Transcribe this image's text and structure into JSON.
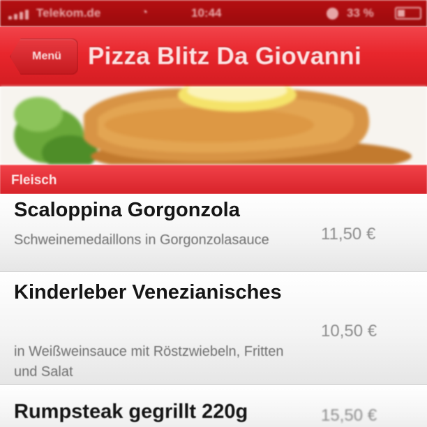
{
  "status_bar": {
    "carrier": "Telekom.de",
    "time": "10:44",
    "battery": "33 %"
  },
  "nav": {
    "back_label": "Menü",
    "title": "Pizza Blitz Da Giovanni"
  },
  "section": {
    "title": "Fleisch"
  },
  "items": [
    {
      "name": "Scaloppina Gorgonzola",
      "description": "Schweinemedaillons in Gorgonzolasauce",
      "price": "11,50 €"
    },
    {
      "name": "Kinderleber Venezianisches",
      "description": "in Weißweinsauce mit Röstzwiebeln, Fritten und Salat",
      "price": "10,50 €"
    },
    {
      "name": "Rumpsteak gegrillt 220g",
      "description": "",
      "price": "15,50 €"
    }
  ],
  "colors": {
    "brand_red": "#e8262c",
    "status_bar_red": "#a80c0f"
  }
}
